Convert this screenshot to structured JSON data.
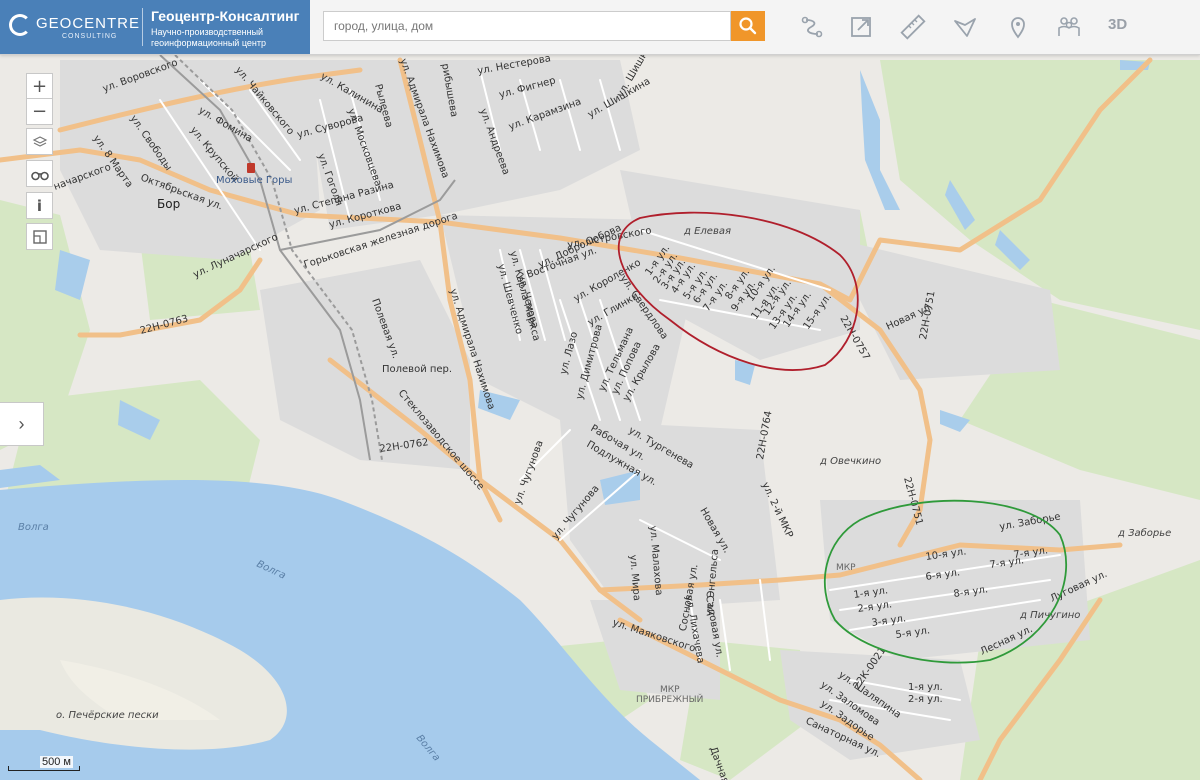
{
  "header": {
    "logo_word": "GEOCENTRE",
    "logo_sub": "CONSULTING",
    "title": "Геоцентр-Консалтинг",
    "subtitle_line1": "Научно-производственный",
    "subtitle_line2": "геоинформационный центр",
    "search_placeholder": "город, улица, дом",
    "tool_3d": "3D",
    "tools": [
      "route-icon",
      "external-link-icon",
      "ruler-icon",
      "area-measure-icon",
      "location-pin-icon",
      "people-icon"
    ]
  },
  "map": {
    "scale_label": "500 м",
    "colors": {
      "land": "#eaeaea",
      "built": "#dedede",
      "green": "#d4e6c2",
      "water": "#aed0ec",
      "river": "#a2c8ea",
      "road": "#f3c48d",
      "road_edge": "#e6a35e",
      "rail": "#9a9a9a",
      "red_circle": "#b21e2a",
      "green_circle": "#2f9a3a"
    },
    "places": {
      "bor": "Бор",
      "mokhovye": "Моховые Горы",
      "eleva": "д Елевая",
      "ovechkino": "д Овечкино",
      "zaborye": "д Заборье",
      "pichugino": "д Пичугино",
      "mkr_pribr_1": "МКР",
      "mkr_pribr_2": "ПРИБРЕЖНЫЙ",
      "mkr_small": "МКР",
      "island": "о. Печёрские пески",
      "volga1": "Волга",
      "volga2": "Волга",
      "volga3": "Волга"
    },
    "roads": {
      "r22n0763": "22Н-0763",
      "r22n0762": "22Н-0762",
      "r22n0757": "22Н-0757",
      "r22n0751a": "22Н-0751",
      "r22n0751b": "22Н-0751",
      "r22n0764": "22Н-0764",
      "r22k0021": "22К-0021",
      "steklo": "Стеклозаводское шоссе",
      "rail": "Горьковская железная дорога"
    },
    "streets": {
      "vorovskogo": "ул. Воровского",
      "svobody": "ул. Свободы",
      "mart8": "ул. 8 Марта",
      "nacharskogo": "начарского",
      "oktyabrskaya": "Октябрьская ул.",
      "lunacharskogo": "ул. Луначарского",
      "fomina": "ул. Фомина",
      "krupskoy": "ул. Крупской",
      "chaykovskogo": "ул. Чайковского",
      "kalinina": "ул. Калинина",
      "ryleeva": "Рылеева",
      "suvorova": "ул. Суворова",
      "moskovtseva": "ул. Московцева",
      "gogolya": "ул. Гоголя",
      "razina": "ул. Степана Разина",
      "korotkova": "ул. Короткова",
      "nakhimova1": "ул. Адмирала Нахимова",
      "nakhimova2": "ул. Адмирала Нахимова",
      "polevaya": "Полевая ул.",
      "polevoy": "Полевой пер.",
      "nesterova": "ул. Нестерова",
      "figner": "ул. Фигнер",
      "andreeva": "ул. Андреева",
      "karamzina": "ул. Карамзина",
      "shishkina1": "ул. Шишкина",
      "shishkina2": "ул. Шишкина",
      "gribysheva": "рибышева",
      "ostrovskogo": "ул. Островского",
      "dobrolyubova": "ул. Добролюбова",
      "vostochnaya": "Восточная ул.",
      "markasa": "ул. Карла Маркса",
      "shevchenko": "ул. Шевченко",
      "chekhova": "ул. Чехова",
      "sverdlova": "ул. Свердлова",
      "korolenko": "ул. Короленко",
      "glinki": "ул. Глинки",
      "lazo": "ул. Лазо",
      "dimitrova": "ул. Димитрова",
      "telmana": "ул. Тельмана",
      "popova": "ул. Попова",
      "krylova": "ул. Крылова",
      "turgeneva": "ул. Тургенева",
      "rabochaya": "Рабочая ул.",
      "podluzhnaya": "Подлужная ул.",
      "chugunova1": "ул. Чугунова",
      "chugunova2": "ул. Чугунова",
      "novaya1": "Новая ул.",
      "novaya2": "Новая ул.",
      "malakhova": "ул. Малахова",
      "mira": "ул. Мира",
      "likhacheva": "ул. Лихачева",
      "sadovaya": "Садовая ул.",
      "sosnovaya": "Сосновая ул.",
      "engelsa": "ул. Энгельса",
      "mayakovskogo": "ул. Маяковского",
      "mkr2": "ул. 2-й МКР",
      "zaborye_st": "ул. Заборье",
      "lugovaya": "Луговая ул.",
      "lesnaya": "Лесная ул.",
      "shalyapina": "ул. Шаляпина",
      "zalomova": "ул. Заломова",
      "zadorye": "ул. Задорье",
      "sanatornaya": "Санаторная ул.",
      "dachnaya": "Дачная"
    },
    "red_area_streets": [
      "1-я ул.",
      "2-я ул.",
      "3-я ул.",
      "4-я ул.",
      "5-я ул.",
      "6-я ул.",
      "7-я ул.",
      "8-я ул.",
      "9-я ул.",
      "10-я ул.",
      "11-я ул.",
      "12-я ул.",
      "13-я ул.",
      "14-я ул.",
      "15-я ул."
    ],
    "green_area_streets": [
      "10-я ул.",
      "6-я ул.",
      "7-я ул.",
      "7-я ул.",
      "8-я ул.",
      "1-я ул.",
      "2-я ул.",
      "3-я ул.",
      "5-я ул."
    ],
    "south_small": [
      "1-я ул.",
      "2-я ул."
    ]
  }
}
